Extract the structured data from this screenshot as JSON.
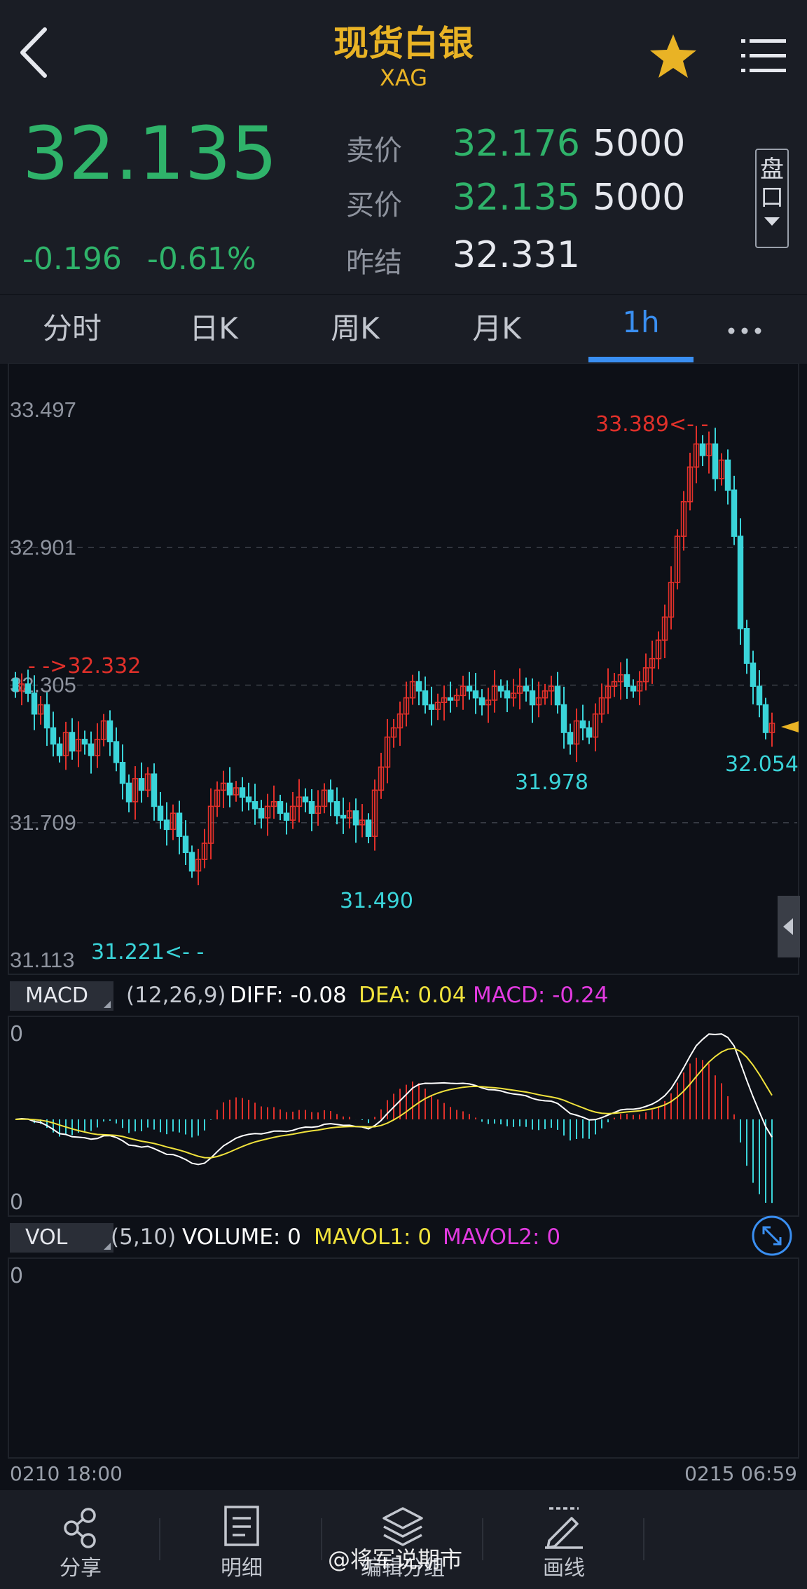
{
  "header": {
    "title": "现货白银",
    "symbol": "XAG"
  },
  "quote": {
    "last": "32.135",
    "change": "-0.196",
    "change_pct": "-0.61%",
    "ask_label": "卖价",
    "ask_price": "32.176",
    "ask_size": "5000",
    "bid_label": "买价",
    "bid_price": "32.135",
    "bid_size": "5000",
    "prev_close_label": "昨结",
    "prev_close": "32.331",
    "pankou_top": "盘",
    "pankou_bottom": "口"
  },
  "tabs": [
    "分时",
    "日K",
    "周K",
    "月K",
    "1h"
  ],
  "active_tab": "1h",
  "chart_data": {
    "type": "candlestick",
    "interval": "1h",
    "y_ticks": [
      "33.497",
      "32.901",
      "32.305",
      "31.709",
      "31.113"
    ],
    "ylim": [
      31.113,
      33.497
    ],
    "annotations": {
      "open_marker": "- ->32.332",
      "high_label": "33.389<- -",
      "low_label": "31.221<- -",
      "low2_label": "31.490",
      "low3_label": "31.978",
      "last_label": "32.054"
    },
    "x_start": "0210 18:00",
    "x_end": "0215 06:59",
    "close_path": [
      32.28,
      32.31,
      32.27,
      32.18,
      32.22,
      32.12,
      32.05,
      32.0,
      32.1,
      32.02,
      32.07,
      32.05,
      32.0,
      32.07,
      32.15,
      32.06,
      31.97,
      31.88,
      31.8,
      31.9,
      31.85,
      31.92,
      31.78,
      31.72,
      31.68,
      31.75,
      31.65,
      31.58,
      31.5,
      31.55,
      31.62,
      31.78,
      31.85,
      31.88,
      31.83,
      31.86,
      31.82,
      31.8,
      31.77,
      31.73,
      31.78,
      31.8,
      31.75,
      31.72,
      31.78,
      31.82,
      31.8,
      31.75,
      31.78,
      31.85,
      31.8,
      31.74,
      31.73,
      31.76,
      31.7,
      31.72,
      31.65,
      31.85,
      31.95,
      32.08,
      32.12,
      32.18,
      32.25,
      32.32,
      32.28,
      32.22,
      32.2,
      32.23,
      32.25,
      32.24,
      32.26,
      32.3,
      32.28,
      32.25,
      32.22,
      32.24,
      32.3,
      32.28,
      32.25,
      32.27,
      32.3,
      32.28,
      32.22,
      32.25,
      32.28,
      32.3,
      32.22,
      32.1,
      32.05,
      32.15,
      32.12,
      32.08,
      32.18,
      32.25,
      32.3,
      32.32,
      32.35,
      32.3,
      32.28,
      32.32,
      32.38,
      32.42,
      32.5,
      32.6,
      32.75,
      32.95,
      33.1,
      33.25,
      33.35,
      33.3,
      33.35,
      33.2,
      33.28,
      33.15,
      32.95,
      32.55,
      32.4,
      32.3,
      32.22,
      32.1,
      32.14
    ],
    "macd": {
      "params": "(12,26,9)",
      "diff_label": "DIFF: -0.08",
      "dea_label": "DEA: 0.04",
      "macd_label": "MACD: -0.24",
      "zero_top": "0",
      "zero_bottom": "0"
    },
    "vol": {
      "params": "(5,10)",
      "volume_label": "VOLUME: 0",
      "mavol1_label": "MAVOL1: 0",
      "mavol2_label": "MAVOL2: 0",
      "zero": "0"
    }
  },
  "indicator_tags": {
    "macd": "MACD",
    "vol": "VOL"
  },
  "toolbar": {
    "share": "分享",
    "detail": "明细",
    "edit_group": "编辑分组",
    "draw": "画线"
  },
  "watermark": "@将军说期市",
  "colors": {
    "up": "#e0302a",
    "down": "#3ad4d9",
    "accent": "#3a8ff2",
    "gold": "#e9b325",
    "green": "#2fb36a"
  }
}
